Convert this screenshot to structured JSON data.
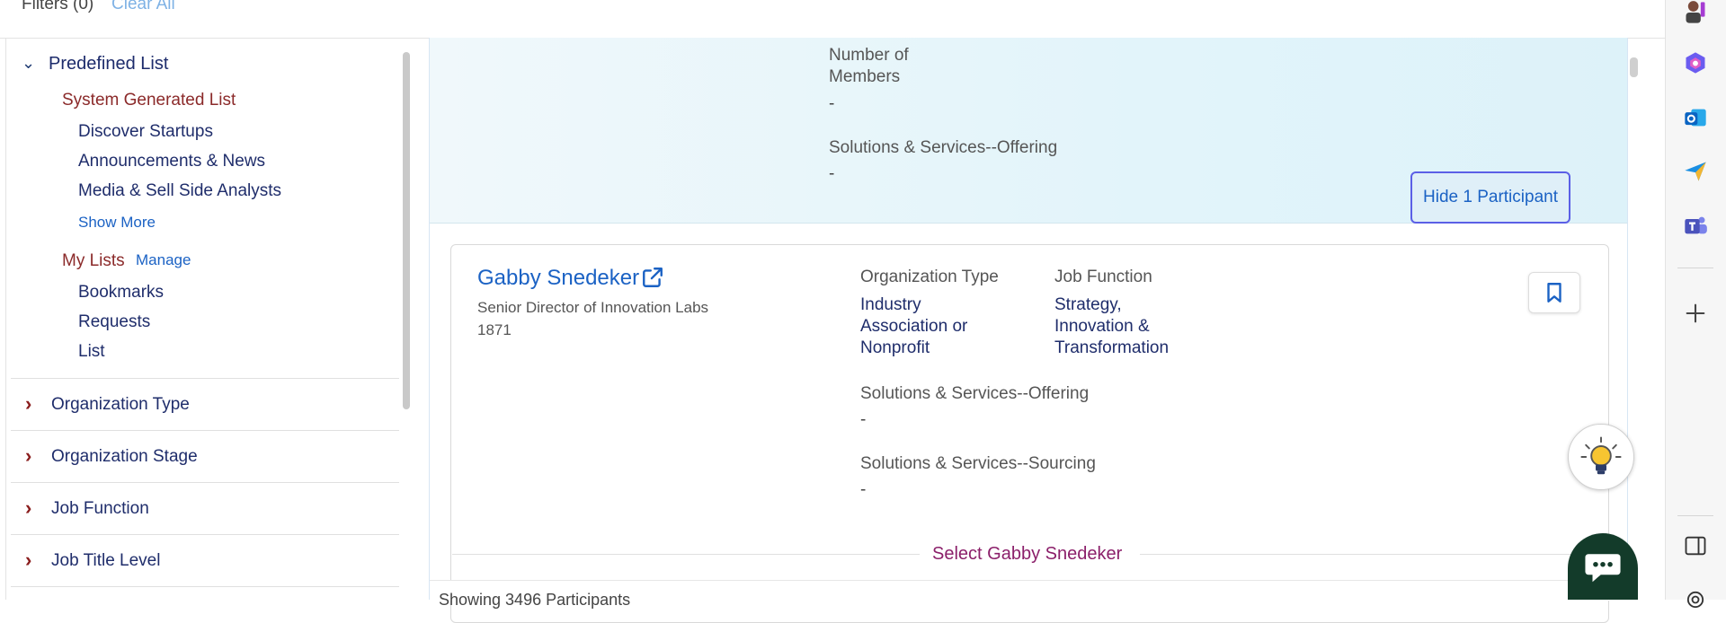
{
  "filters": {
    "label": "Filters (0)",
    "clear_all": "Clear All"
  },
  "sidebar": {
    "predefined_heading": "Predefined List",
    "system_generated_heading": "System Generated List",
    "system_items": [
      "Discover Startups",
      "Announcements & News",
      "Media & Sell Side Analysts"
    ],
    "show_more": "Show More",
    "my_lists_heading": "My Lists",
    "manage": "Manage",
    "my_lists_items": [
      "Bookmarks",
      "Requests",
      "List"
    ],
    "filters": [
      "Organization Type",
      "Organization Stage",
      "Job Function",
      "Job Title Level"
    ]
  },
  "highlight_card": {
    "members_label": "Number of Members",
    "members_label_line1": "Number of",
    "members_label_line2": "Members",
    "members_value": "-",
    "offering_label": "Solutions & Services--Offering",
    "offering_value": "-",
    "hide_button": "Hide 1 Participant"
  },
  "participant": {
    "name": "Gabby Snedeker",
    "title": "Senior Director of Innovation Labs",
    "organization": "1871",
    "org_type_label": "Organization Type",
    "org_type_value": [
      "Industry",
      "Association or",
      "Nonprofit"
    ],
    "job_function_label": "Job Function",
    "job_function_value": [
      "Strategy,",
      "Innovation &",
      "Transformation"
    ],
    "offering_label": "Solutions & Services--Offering",
    "offering_value": "-",
    "sourcing_label": "Solutions & Services--Sourcing",
    "sourcing_value": "-",
    "select_label": "Select Gabby Snedeker"
  },
  "footer": {
    "showing_text": "Showing 3496 Participants"
  },
  "icons": {
    "external_link": "external-link-icon",
    "bookmark": "bookmark-icon",
    "bulb": "lightbulb-icon",
    "chat": "chat-icon"
  },
  "colors": {
    "accent_blue": "#1b62c4",
    "select_magenta": "#8b1f6a",
    "category_red": "#8b2a2a",
    "chat_green": "#133b2a",
    "hide_border": "#5b5fe6"
  }
}
